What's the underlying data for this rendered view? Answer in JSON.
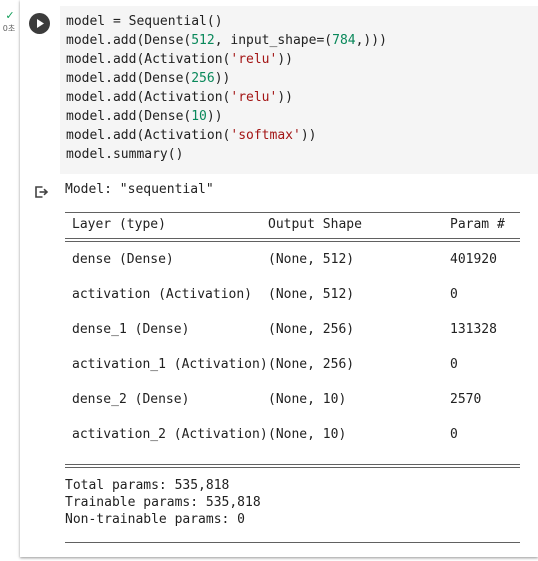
{
  "gutter": {
    "status_icon": "check-icon",
    "status_glyph": "✓",
    "exec_time": "0초"
  },
  "run_button": {
    "icon": "play-icon"
  },
  "code": {
    "lines": [
      "model = Sequential()",
      "model.add(Dense(512, input_shape=(784,)))",
      "model.add(Activation('relu'))",
      "model.add(Dense(256))",
      "model.add(Activation('relu'))",
      "model.add(Dense(10))",
      "model.add(Activation('softmax'))",
      "model.summary()"
    ]
  },
  "output": {
    "icon": "output-redirect-icon",
    "model_label": "Model: \"sequential\"",
    "headers": {
      "layer": "Layer (type)",
      "shape": "Output Shape",
      "params": "Param #"
    },
    "rows": [
      {
        "layer": "dense (Dense)",
        "shape": "(None, 512)",
        "params": "401920"
      },
      {
        "layer": "activation (Activation)",
        "shape": "(None, 512)",
        "params": "0"
      },
      {
        "layer": "dense_1 (Dense)",
        "shape": "(None, 256)",
        "params": "131328"
      },
      {
        "layer": "activation_1 (Activation)",
        "shape": "(None, 256)",
        "params": "0"
      },
      {
        "layer": "dense_2 (Dense)",
        "shape": "(None, 10)",
        "params": "2570"
      },
      {
        "layer": "activation_2 (Activation)",
        "shape": "(None, 10)",
        "params": "0"
      }
    ],
    "totals": {
      "total": "Total params: 535,818",
      "trainable": "Trainable params: 535,818",
      "non_trainable": "Non-trainable params: 0"
    }
  },
  "colors": {
    "number": "#09885a",
    "string": "#a31515",
    "code_background": "#f5f5f5",
    "run_button": "#3c3c3c"
  }
}
